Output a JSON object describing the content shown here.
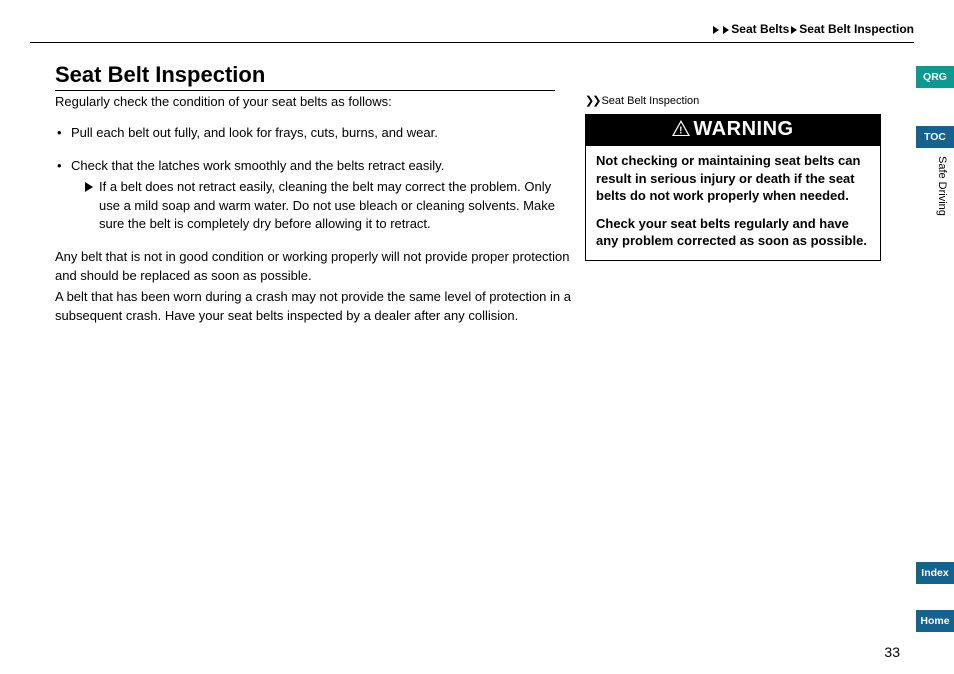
{
  "breadcrumb": {
    "level1": "Seat Belts",
    "level2": "Seat Belt Inspection"
  },
  "heading": "Seat Belt Inspection",
  "intro": "Regularly check the condition of your seat belts as follows:",
  "bullets": [
    {
      "text": "Pull each belt out fully, and look for frays, cuts, burns, and wear.",
      "sub": null
    },
    {
      "text": "Check that the latches work smoothly and the belts retract easily.",
      "sub": "If a belt does not retract easily, cleaning the belt may correct the problem. Only use a mild soap and warm water. Do not use bleach or cleaning solvents. Make sure the belt is completely dry before allowing it to retract."
    }
  ],
  "paragraphs": [
    "Any belt that is not in good condition or working properly will not provide proper protection and should be replaced as soon as possible.",
    "A belt that has been worn during a crash may not provide the same level of protection in a subsequent crash. Have your seat belts inspected by a dealer after any collision."
  ],
  "side_marker": "Seat Belt Inspection",
  "warning": {
    "title": "WARNING",
    "p1": "Not checking or maintaining seat belts can result in serious injury or death if the seat belts do not work properly when needed.",
    "p2": "Check your seat belts regularly and have any problem corrected as soon as possible."
  },
  "tabs": {
    "qrg": "QRG",
    "toc": "TOC",
    "index": "Index",
    "home": "Home"
  },
  "section_label": "Safe Driving",
  "page_number": "33"
}
